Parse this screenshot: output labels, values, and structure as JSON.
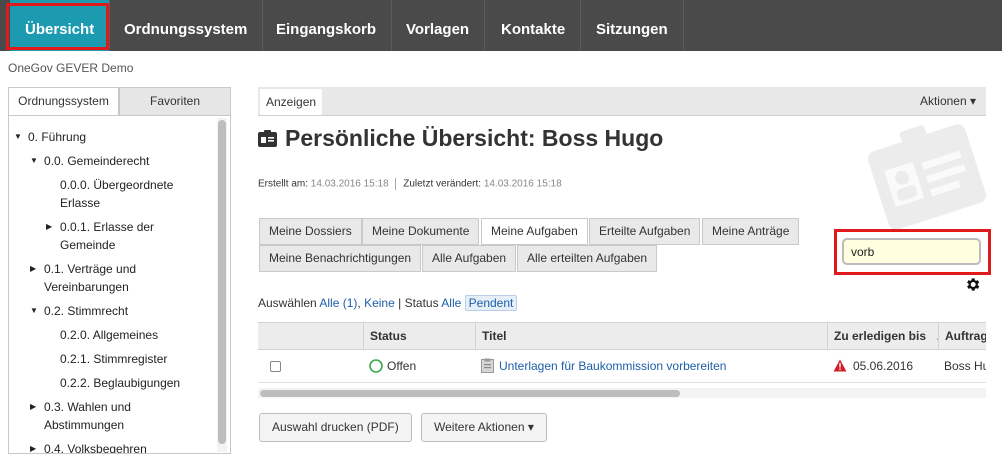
{
  "nav": {
    "items": [
      "Übersicht",
      "Ordnungssystem",
      "Eingangskorb",
      "Vorlagen",
      "Kontakte",
      "Sitzungen"
    ],
    "active": "Übersicht",
    "active_color": "#1b9ab0",
    "bar_color": "#4a4a4a",
    "highlight_color": "#e0191b"
  },
  "site_title": "OneGov GEVER Demo",
  "left_tabs": {
    "ordnungssystem": "Ordnungssystem",
    "favoriten": "Favoriten"
  },
  "tree": {
    "items": [
      {
        "label_1": "0. Führung",
        "expanded": true
      },
      {
        "label_1": "0.0. Gemeinderecht",
        "expanded": true
      },
      {
        "label_1": "0.0.0. Übergeordnete",
        "label_2": "Erlasse"
      },
      {
        "label_1": "0.0.1. Erlasse der",
        "label_2": "Gemeinde",
        "expanded": false
      },
      {
        "label_1": "0.1. Verträge und",
        "label_2": "Vereinbarungen",
        "expanded": false
      },
      {
        "label_1": "0.2. Stimmrecht",
        "expanded": true
      },
      {
        "label_1": "0.2.0. Allgemeines"
      },
      {
        "label_1": "0.2.1. Stimmregister"
      },
      {
        "label_1": "0.2.2. Beglaubigungen"
      },
      {
        "label_1": "0.3. Wahlen und",
        "label_2": "Abstimmungen",
        "expanded": false
      },
      {
        "label_1": "0.4. Volksbegehren",
        "expanded": false
      }
    ]
  },
  "toolbar": {
    "show": "Anzeigen",
    "actions": "Aktionen ▾"
  },
  "page": {
    "title": "Persönliche Übersicht: Boss Hugo",
    "title_icon": "id-card-icon"
  },
  "meta": {
    "created_label": "Erstellt am:",
    "created": "14.03.2016 15:18",
    "modified_label": "Zuletzt verändert:",
    "modified": "14.03.2016 15:18"
  },
  "tabs": {
    "row1": [
      "Meine Dossiers",
      "Meine Dokumente",
      "Meine Aufgaben",
      "Erteilte Aufgaben",
      "Meine Anträge"
    ],
    "row2": [
      "Meine Benachrichtigungen",
      "Alle Aufgaben",
      "Alle erteilten Aufgaben"
    ],
    "active": "Meine Aufgaben"
  },
  "search": {
    "value": "vorb"
  },
  "filter": {
    "select_label": "Auswählen",
    "all": "Alle (1)",
    "none": "Keine",
    "status_label": "Status",
    "status_all": "Alle",
    "status_pending": "Pendent"
  },
  "table": {
    "headers": [
      "Status",
      "Titel",
      "Zu erledigen bis",
      "Auftrag"
    ],
    "sort_icon": "↓",
    "rows": [
      {
        "status": "Offen",
        "title": "Unterlagen für Baukommission vorbereiten",
        "due": "05.06.2016",
        "assigned": "Boss Hu"
      }
    ]
  },
  "buttons": {
    "print": "Auswahl drucken (PDF)",
    "more": "Weitere Aktionen ▾"
  }
}
